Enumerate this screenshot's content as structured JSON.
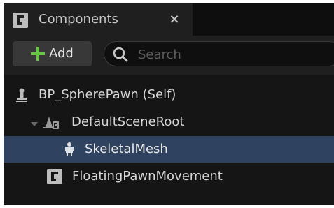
{
  "tab": {
    "title": "Components",
    "close_glyph": "×",
    "icon": "component-class-icon"
  },
  "toolbar": {
    "add_label": "Add",
    "add_icon": "plus-icon",
    "search_placeholder": "Search",
    "search_value": ""
  },
  "tree": {
    "items": [
      {
        "label": "BP_SpherePawn (Self)",
        "icon": "pawn-icon",
        "selected": false
      },
      {
        "label": "DefaultSceneRoot",
        "icon": "scene-component-icon",
        "selected": false,
        "expanded": true
      },
      {
        "label": "SkeletalMesh",
        "icon": "skeletal-mesh-icon",
        "selected": true
      },
      {
        "label": "FloatingPawnMovement",
        "icon": "component-class-icon",
        "selected": false
      }
    ]
  },
  "colors": {
    "panel_bg": "#151515",
    "tab_bg": "#1f1f1f",
    "selected_row": "#2f4360",
    "add_plus": "#6ac247",
    "text": "#d6d6d6"
  }
}
